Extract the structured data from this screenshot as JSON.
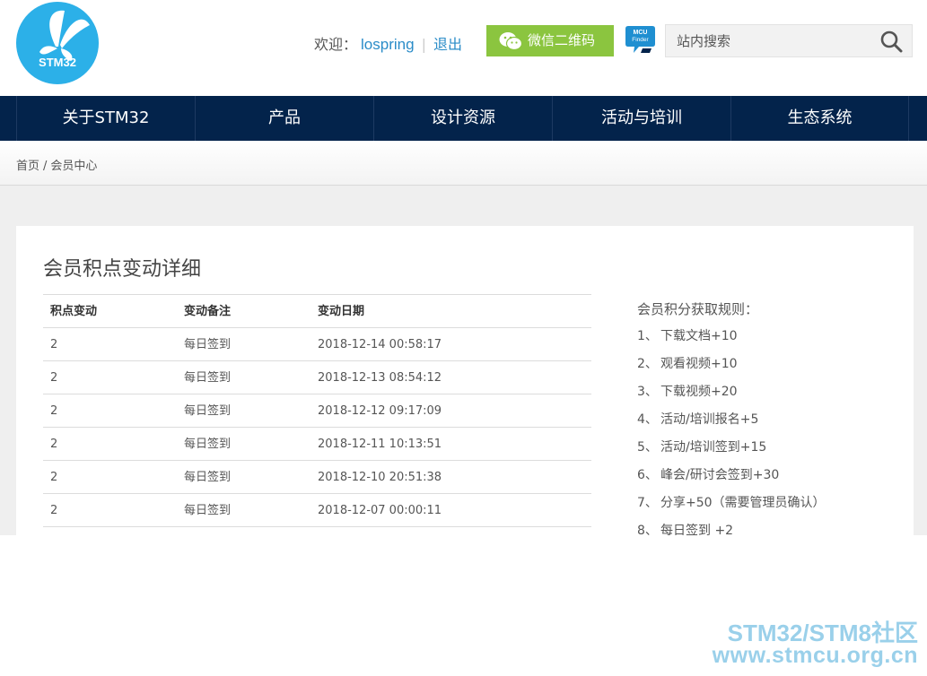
{
  "header": {
    "logo_text": "STM32",
    "welcome_label": "欢迎：",
    "username": "lospring",
    "separator": "|",
    "logout": "退出",
    "wechat_button": "微信二维码",
    "mcu_finder_line1": "MCU",
    "mcu_finder_line2": "Finder",
    "search_placeholder": "站内搜索"
  },
  "nav": {
    "items": [
      {
        "label": "关于STM32"
      },
      {
        "label": "产品"
      },
      {
        "label": "设计资源"
      },
      {
        "label": "活动与培训"
      },
      {
        "label": "生态系统"
      }
    ]
  },
  "breadcrumb": {
    "home": "首页",
    "separator": "/",
    "current": "会员中心"
  },
  "main": {
    "title": "会员积点变动详细",
    "table": {
      "headers": [
        "积点变动",
        "变动备注",
        "变动日期"
      ],
      "rows": [
        [
          "2",
          "每日签到",
          "2018-12-14 00:58:17"
        ],
        [
          "2",
          "每日签到",
          "2018-12-13 08:54:12"
        ],
        [
          "2",
          "每日签到",
          "2018-12-12 09:17:09"
        ],
        [
          "2",
          "每日签到",
          "2018-12-11 10:13:51"
        ],
        [
          "2",
          "每日签到",
          "2018-12-10 20:51:38"
        ],
        [
          "2",
          "每日签到",
          "2018-12-07 00:00:11"
        ]
      ]
    },
    "rules": {
      "title": "会员积分获取规则：",
      "items": [
        {
          "num": "1、",
          "text": "下载文档+10"
        },
        {
          "num": "2、",
          "text": "观看视频+10"
        },
        {
          "num": "3、",
          "text": "下载视频+20"
        },
        {
          "num": "4、",
          "text": "活动/培训报名+5"
        },
        {
          "num": "5、",
          "text": "活动/培训签到+15"
        },
        {
          "num": "6、",
          "text": "峰会/研讨会签到+30"
        },
        {
          "num": "7、",
          "text": "分享+50（需要管理员确认）"
        },
        {
          "num": "8、",
          "text": "每日签到 +2"
        }
      ]
    }
  },
  "watermark": {
    "line1": "STM32/STM8社区",
    "line2": "www.stmcu.org.cn"
  },
  "colors": {
    "nav_bg": "#03234b",
    "logo_bg": "#2cb0e8",
    "wechat_green": "#8bc53f",
    "link_blue": "#2a8cc8"
  }
}
